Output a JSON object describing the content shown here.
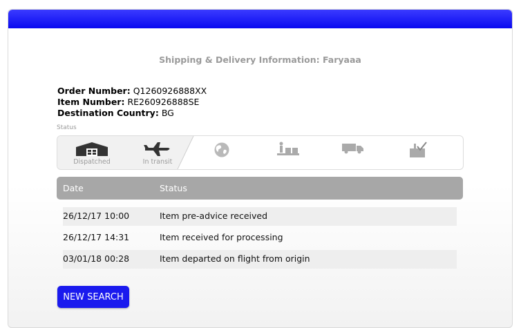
{
  "heading": "Shipping & Delivery Information: Faryaaa",
  "order": {
    "order_label": "Order Number:",
    "order_value": "Q1260926888XX",
    "item_label": "Item Number:",
    "item_value": "RE260926888SE",
    "country_label": "Destination Country:",
    "country_value": "BG"
  },
  "status_label": "Status",
  "tracker": {
    "steps": [
      {
        "label": "Dispatched",
        "icon": "warehouse-icon",
        "completed": true
      },
      {
        "label": "In transit",
        "icon": "airplane-icon",
        "completed": true
      },
      {
        "label": "",
        "icon": "globe-icon",
        "completed": false
      },
      {
        "label": "",
        "icon": "customs-icon",
        "completed": false
      },
      {
        "label": "",
        "icon": "delivery-truck-icon",
        "completed": false
      },
      {
        "label": "",
        "icon": "delivered-box-icon",
        "completed": false
      }
    ]
  },
  "table": {
    "headers": [
      "Date",
      "Status"
    ],
    "rows": [
      {
        "date": "26/12/17 10:00",
        "status": "Item pre-advice received"
      },
      {
        "date": "26/12/17 14:31",
        "status": "Item received for processing"
      },
      {
        "date": "03/01/18 00:28",
        "status": "Item departed on flight from origin"
      }
    ]
  },
  "button": {
    "label": "NEW SEARCH"
  },
  "colors": {
    "topbar": "#1010f0",
    "button": "#1a1aee",
    "table_header": "#a7a7a7"
  }
}
